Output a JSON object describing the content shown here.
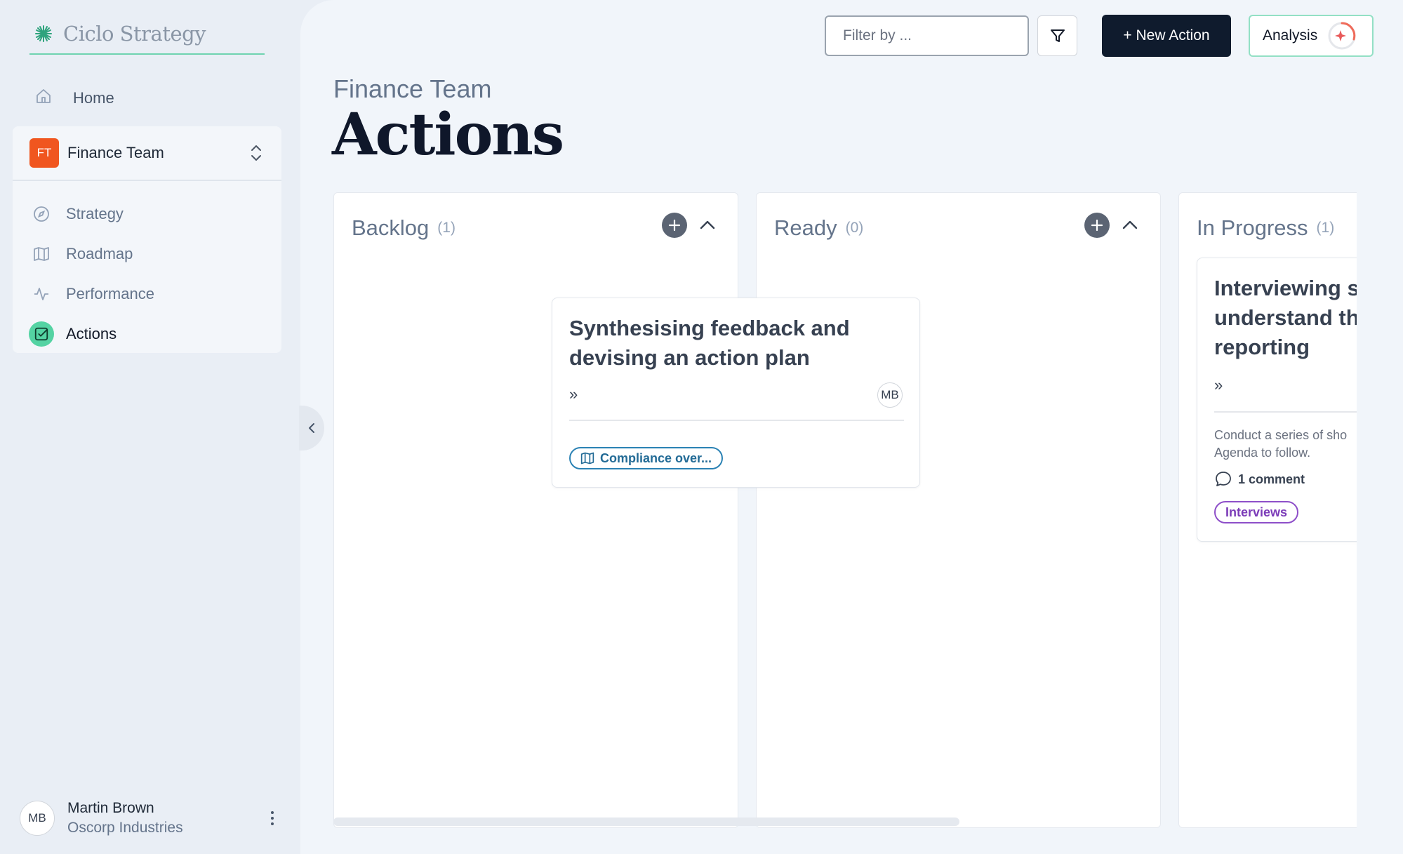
{
  "brand": {
    "name": "Ciclo Strategy",
    "accent": "#54d3a3"
  },
  "sidebar": {
    "home_label": "Home",
    "team": {
      "badge": "FT",
      "name": "Finance Team",
      "badge_color": "#f0561f"
    },
    "items": [
      {
        "label": "Strategy",
        "icon": "compass-icon"
      },
      {
        "label": "Roadmap",
        "icon": "map-icon"
      },
      {
        "label": "Performance",
        "icon": "pulse-icon"
      },
      {
        "label": "Actions",
        "icon": "checkbox-icon",
        "active": true
      }
    ],
    "user": {
      "initials": "MB",
      "name": "Martin Brown",
      "org": "Oscorp Industries"
    }
  },
  "header": {
    "filter_placeholder": "Filter by ...",
    "new_action_label": "+ New Action",
    "analysis_label": "Analysis"
  },
  "page": {
    "subtitle": "Finance Team",
    "title": "Actions"
  },
  "board": {
    "columns": [
      {
        "title": "Backlog",
        "count": "(1)"
      },
      {
        "title": "Ready",
        "count": "(0)"
      },
      {
        "title": "In Progress",
        "count": "(1)"
      }
    ],
    "cards": {
      "backlog": {
        "title": "Synthesising feedback and devising an action plan",
        "expand": "»",
        "assignee": "MB",
        "tag": "Compliance over..."
      },
      "in_progress": {
        "title": "Interviewing s understand th reporting",
        "title_lines": [
          "Interviewing s",
          "understand th",
          "reporting"
        ],
        "expand": "»",
        "desc_lines": [
          "Conduct a series of sho",
          "Agenda to follow."
        ],
        "comments": "1 comment",
        "tag": "Interviews"
      }
    }
  }
}
